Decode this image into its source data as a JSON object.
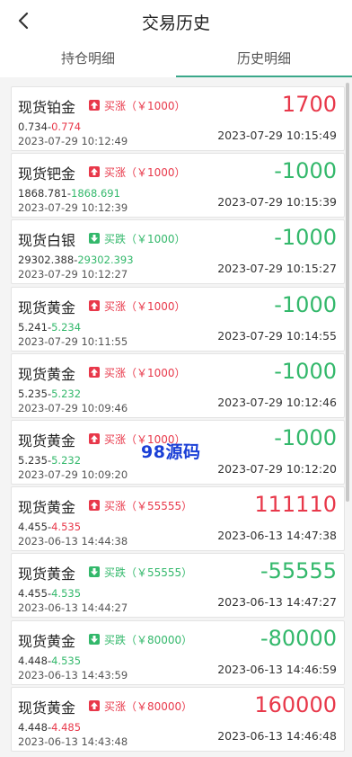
{
  "header": {
    "title": "交易历史"
  },
  "tabs": [
    {
      "label": "持仓明细",
      "active": false
    },
    {
      "label": "历史明细",
      "active": true
    }
  ],
  "watermark": "98源码",
  "colors": {
    "up": "#e8384a",
    "down": "#33b86b",
    "tab_indicator": "#3aa88a"
  },
  "trades": [
    {
      "name": "现货铂金",
      "direction": "up",
      "action": "买涨（￥1000）",
      "open_price": "0.734",
      "close_price": "0.774",
      "open_time": "2023-07-29 10:12:49",
      "profit": "1700",
      "close_time": "2023-07-29 10:15:49"
    },
    {
      "name": "现货钯金",
      "direction": "up",
      "action": "买涨（￥1000）",
      "open_price": "1868.781",
      "close_price": "1868.691",
      "open_time": "2023-07-29 10:12:39",
      "profit": "-1000",
      "close_time": "2023-07-29 10:15:39"
    },
    {
      "name": "现货白银",
      "direction": "down",
      "action": "买跌（￥1000）",
      "open_price": "29302.388",
      "close_price": "29302.393",
      "open_time": "2023-07-29 10:12:27",
      "profit": "-1000",
      "close_time": "2023-07-29 10:15:27"
    },
    {
      "name": "现货黄金",
      "direction": "up",
      "action": "买涨（￥1000）",
      "open_price": "5.241",
      "close_price": "5.234",
      "open_time": "2023-07-29 10:11:55",
      "profit": "-1000",
      "close_time": "2023-07-29 10:14:55"
    },
    {
      "name": "现货黄金",
      "direction": "up",
      "action": "买涨（￥1000）",
      "open_price": "5.235",
      "close_price": "5.232",
      "open_time": "2023-07-29 10:09:46",
      "profit": "-1000",
      "close_time": "2023-07-29 10:12:46"
    },
    {
      "name": "现货黄金",
      "direction": "up",
      "action": "买涨（￥1000）",
      "open_price": "5.235",
      "close_price": "5.232",
      "open_time": "2023-07-29 10:09:20",
      "profit": "-1000",
      "close_time": "2023-07-29 10:12:20"
    },
    {
      "name": "现货黄金",
      "direction": "up",
      "action": "买涨（￥55555）",
      "open_price": "4.455",
      "close_price": "4.535",
      "open_time": "2023-06-13 14:44:38",
      "profit": "111110",
      "close_time": "2023-06-13 14:47:38"
    },
    {
      "name": "现货黄金",
      "direction": "down",
      "action": "买跌（￥55555）",
      "open_price": "4.455",
      "close_price": "4.535",
      "open_time": "2023-06-13 14:44:27",
      "profit": "-55555",
      "close_time": "2023-06-13 14:47:27"
    },
    {
      "name": "现货黄金",
      "direction": "down",
      "action": "买跌（￥80000）",
      "open_price": "4.448",
      "close_price": "4.535",
      "open_time": "2023-06-13 14:43:59",
      "profit": "-80000",
      "close_time": "2023-06-13 14:46:59"
    },
    {
      "name": "现货黄金",
      "direction": "up",
      "action": "买涨（￥80000）",
      "open_price": "4.448",
      "close_price": "4.485",
      "open_time": "2023-06-13 14:43:48",
      "profit": "160000",
      "close_time": "2023-06-13 14:46:48"
    }
  ]
}
